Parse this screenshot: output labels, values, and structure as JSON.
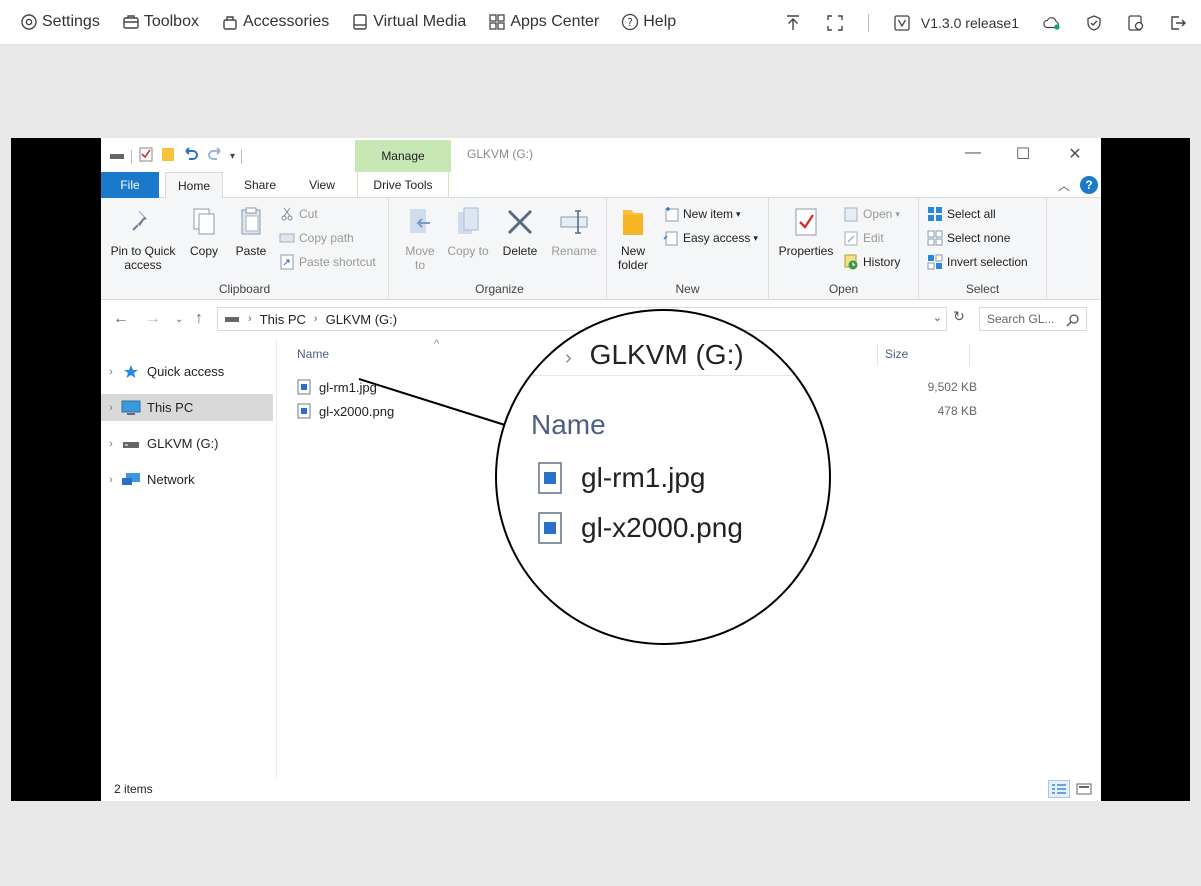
{
  "topbar": {
    "menu": [
      {
        "label": "Settings",
        "icon": "settings-icon"
      },
      {
        "label": "Toolbox",
        "icon": "toolbox-icon"
      },
      {
        "label": "Accessories",
        "icon": "accessories-icon"
      },
      {
        "label": "Virtual Media",
        "icon": "virtual-media-icon"
      },
      {
        "label": "Apps Center",
        "icon": "apps-grid-icon"
      },
      {
        "label": "Help",
        "icon": "help-icon"
      }
    ],
    "version": "V1.3.0 release1",
    "accent_color": "#1aa37a"
  },
  "explorer": {
    "window_title": "GLKVM (G:)",
    "contextual_tab": "Manage",
    "tabs": [
      "File",
      "Home",
      "Share",
      "View",
      "Drive Tools"
    ],
    "ribbon": {
      "clipboard": {
        "label": "Clipboard",
        "pin": "Pin to Quick access",
        "copy": "Copy",
        "paste": "Paste",
        "cut": "Cut",
        "copy_path": "Copy path",
        "paste_shortcut": "Paste shortcut"
      },
      "organize": {
        "label": "Organize",
        "move_to": "Move to",
        "copy_to": "Copy to",
        "delete": "Delete",
        "rename": "Rename"
      },
      "new": {
        "label": "New",
        "new_folder": "New folder",
        "new_item": "New item",
        "easy_access": "Easy access"
      },
      "open": {
        "label": "Open",
        "properties": "Properties",
        "open": "Open",
        "edit": "Edit",
        "history": "History"
      },
      "select": {
        "label": "Select",
        "select_all": "Select all",
        "select_none": "Select none",
        "invert_selection": "Invert selection"
      }
    },
    "address": {
      "crumbs": [
        "This PC",
        "GLKVM (G:)"
      ],
      "search_placeholder": "Search GL..."
    },
    "nav_pane": [
      {
        "label": "Quick access",
        "icon": "star-icon",
        "selected": false
      },
      {
        "label": "This PC",
        "icon": "computer-icon",
        "selected": true
      },
      {
        "label": "GLKVM (G:)",
        "icon": "drive-icon",
        "selected": false
      },
      {
        "label": "Network",
        "icon": "network-icon",
        "selected": false
      }
    ],
    "columns": {
      "name": "Name",
      "size": "Size"
    },
    "files": [
      {
        "name": "gl-rm1.jpg",
        "size": "9,502 KB"
      },
      {
        "name": "gl-x2000.png",
        "size": "478 KB"
      }
    ],
    "status": "2 items"
  },
  "magnifier": {
    "crumb": "GLKVM (G:)",
    "column": "Name",
    "files": [
      "gl-rm1.jpg",
      "gl-x2000.png"
    ]
  }
}
